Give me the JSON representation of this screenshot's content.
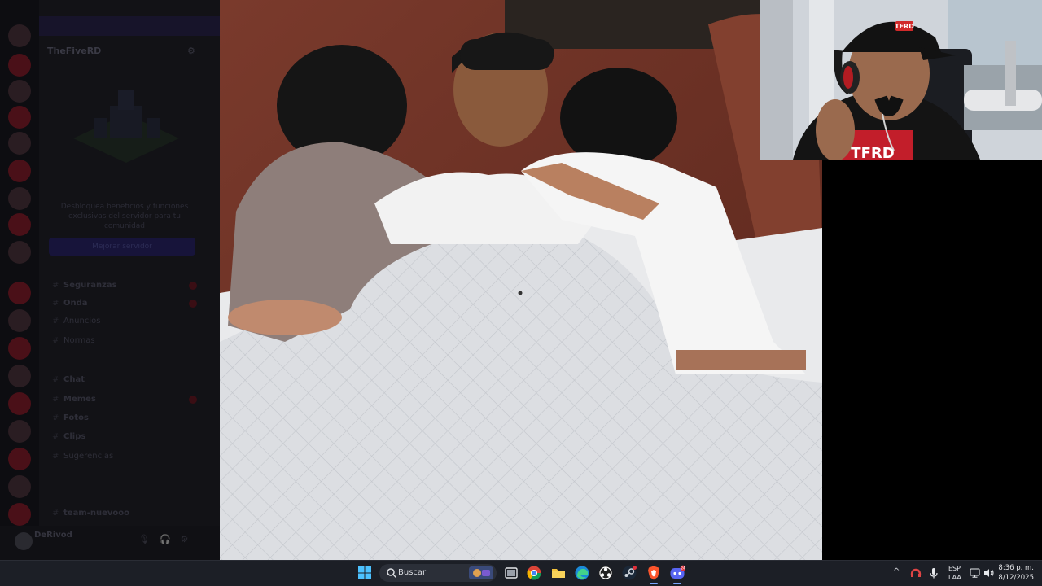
{
  "discord": {
    "server_name": "TheFiveRD",
    "boost_text": "Desbloquea beneficios y funciones exclusivas del servidor para tu comunidad",
    "boost_button": "Mejorar servidor",
    "channels": [
      {
        "name": "Seguranzas",
        "bold": true,
        "badge": true
      },
      {
        "name": "Onda",
        "bold": true,
        "badge": true
      },
      {
        "name": "Anuncios",
        "bold": false,
        "badge": false
      },
      {
        "name": "Normas",
        "bold": false,
        "badge": false
      },
      {
        "name": "Chat",
        "bold": true,
        "badge": false
      },
      {
        "name": "Memes",
        "bold": true,
        "badge": true
      },
      {
        "name": "Fotos",
        "bold": true,
        "badge": false
      },
      {
        "name": "Clips",
        "bold": true,
        "badge": false
      },
      {
        "name": "Sugerencias",
        "bold": false,
        "badge": false
      },
      {
        "name": "team-nuevooo",
        "bold": true,
        "badge": false
      }
    ],
    "user": {
      "name": "DeRivod",
      "status": ""
    }
  },
  "photo": {
    "subject": "three people lying in bed under a quilted white blanket",
    "palette": {
      "wall": "#7a3a2c",
      "blanket": "#d8dadd",
      "shirt": "#f2f2f2",
      "hair": "#141414"
    }
  },
  "webcam": {
    "subject": "streamer wearing headset and black cap",
    "cap_logo": "TFRD",
    "shirt_text": "TFRD"
  },
  "taskbar": {
    "search_label": "Buscar",
    "apps": [
      "task-view",
      "chrome",
      "file-explorer",
      "edge",
      "obs",
      "steam",
      "brave",
      "discord"
    ],
    "notification_badge": "24",
    "lang_line1": "ESP",
    "lang_line2": "LAA",
    "time": "8:36 p. m.",
    "date": "8/12/2025"
  },
  "colors": {
    "taskbar": "#1c1f26",
    "accent": "#7aa6ff",
    "discord_bg": "#131318"
  }
}
